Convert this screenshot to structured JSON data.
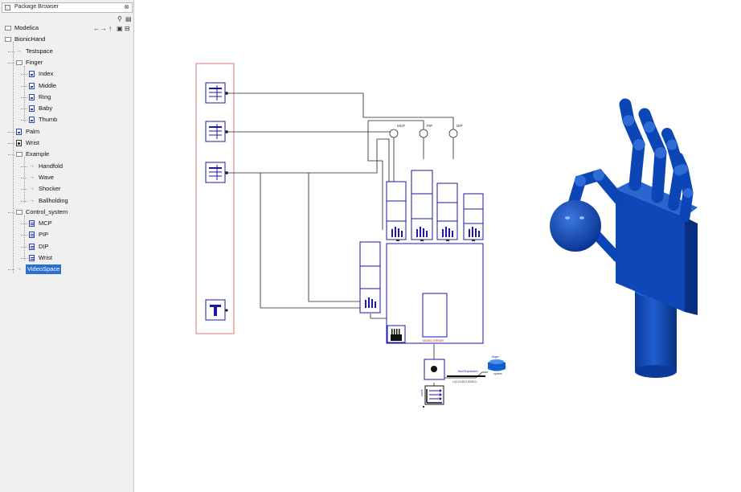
{
  "package_browser": {
    "title": "Package Browser",
    "close_glyph": "⊗",
    "search_icon": "search-icon",
    "nav_glyphs": [
      "←",
      "→",
      "↑"
    ],
    "tree": [
      {
        "label": "Modelica",
        "icon": "package-icon",
        "level": 0
      },
      {
        "label": "BionicHand",
        "icon": "package-icon",
        "level": 0
      },
      {
        "label": "Testspace",
        "icon": "arrow-icon",
        "level": 1
      },
      {
        "label": "Finger",
        "icon": "package-icon",
        "level": 1
      },
      {
        "label": "Index",
        "icon": "model-icon",
        "level": 2
      },
      {
        "label": "Middle",
        "icon": "model-icon",
        "level": 2
      },
      {
        "label": "Ring",
        "icon": "model-icon",
        "level": 2
      },
      {
        "label": "Baby",
        "icon": "model-icon",
        "level": 2
      },
      {
        "label": "Thumb",
        "icon": "model-icon",
        "level": 2
      },
      {
        "label": "Palm",
        "icon": "model-icon",
        "level": 1
      },
      {
        "label": "Wrist",
        "icon": "dot-icon",
        "level": 1
      },
      {
        "label": "Example",
        "icon": "package-icon",
        "level": 1
      },
      {
        "label": "Handfold",
        "icon": "arrow-icon",
        "level": 2
      },
      {
        "label": "Wave",
        "icon": "arrow-icon",
        "level": 2
      },
      {
        "label": "Shocker",
        "icon": "arrow-icon",
        "level": 2
      },
      {
        "label": "Ballholding",
        "icon": "arrow-icon",
        "level": 2
      },
      {
        "label": "Control_system",
        "icon": "package-icon",
        "level": 1
      },
      {
        "label": "MCP",
        "icon": "controller-icon",
        "level": 2
      },
      {
        "label": "PIP",
        "icon": "controller-icon",
        "level": 2
      },
      {
        "label": "DIP",
        "icon": "controller-icon",
        "level": 2
      },
      {
        "label": "Wrist",
        "icon": "controller-icon",
        "level": 2
      },
      {
        "label": "VideoSpace",
        "icon": "arrow-icon",
        "level": 1,
        "selected": true
      }
    ]
  },
  "diagram": {
    "signal_labels": [
      "MCP",
      "PIP",
      "DIP"
    ],
    "palm_label": "MODEL ERROR",
    "fixed_translation_label": "fixedTranslation",
    "fixed_translation_value": "r={0.0145,0.0005,0...",
    "world_label": "world",
    "finger_label": "finger",
    "sphere_label": "sphere"
  },
  "colors": {
    "diagram_blue": "#1a1aa8",
    "selection_blue": "#2a6fd6",
    "group_border": "#e07070",
    "hand_blue": "#0b4ab8"
  }
}
